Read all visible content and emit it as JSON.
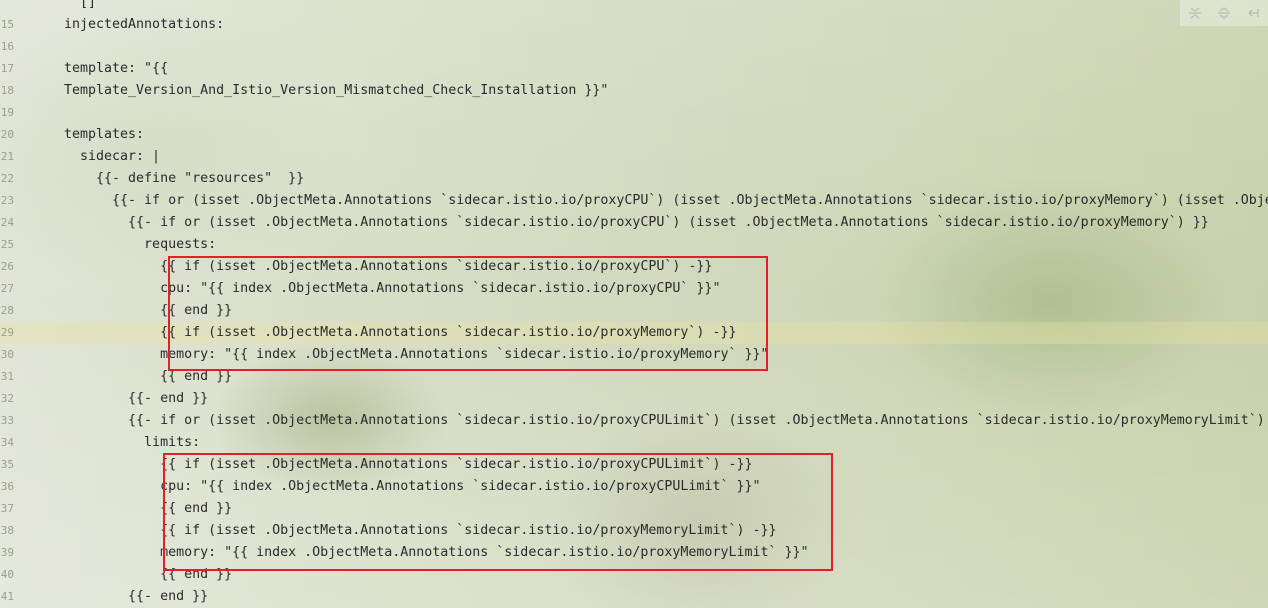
{
  "editor": {
    "lines": [
      {
        "number": "",
        "text": "  []"
      },
      {
        "number": "15",
        "text": "injectedAnnotations:"
      },
      {
        "number": "16",
        "text": ""
      },
      {
        "number": "17",
        "text": "template: \"{{"
      },
      {
        "number": "18",
        "text": "Template_Version_And_Istio_Version_Mismatched_Check_Installation }}\""
      },
      {
        "number": "19",
        "text": ""
      },
      {
        "number": "20",
        "text": "templates:"
      },
      {
        "number": "21",
        "text": "  sidecar: |"
      },
      {
        "number": "22",
        "text": "    {{- define \"resources\"  }}"
      },
      {
        "number": "23",
        "text": "      {{- if or (isset .ObjectMeta.Annotations `sidecar.istio.io/proxyCPU`) (isset .ObjectMeta.Annotations `sidecar.istio.io/proxyMemory`) (isset .ObjectMeta.Annotations"
      },
      {
        "number": "24",
        "text": "        {{- if or (isset .ObjectMeta.Annotations `sidecar.istio.io/proxyCPU`) (isset .ObjectMeta.Annotations `sidecar.istio.io/proxyMemory`) }}"
      },
      {
        "number": "25",
        "text": "          requests:"
      },
      {
        "number": "26",
        "text": "            {{ if (isset .ObjectMeta.Annotations `sidecar.istio.io/proxyCPU`) -}}"
      },
      {
        "number": "27",
        "text": "            cpu: \"{{ index .ObjectMeta.Annotations `sidecar.istio.io/proxyCPU` }}\""
      },
      {
        "number": "28",
        "text": "            {{ end }}"
      },
      {
        "number": "29",
        "text": "            {{ if (isset .ObjectMeta.Annotations `sidecar.istio.io/proxyMemory`) -}}"
      },
      {
        "number": "30",
        "text": "            memory: \"{{ index .ObjectMeta.Annotations `sidecar.istio.io/proxyMemory` }}\""
      },
      {
        "number": "31",
        "text": "            {{ end }}"
      },
      {
        "number": "32",
        "text": "        {{- end }}"
      },
      {
        "number": "33",
        "text": "        {{- if or (isset .ObjectMeta.Annotations `sidecar.istio.io/proxyCPULimit`) (isset .ObjectMeta.Annotations `sidecar.istio.io/proxyMemoryLimit`) }}"
      },
      {
        "number": "34",
        "text": "          limits:"
      },
      {
        "number": "35",
        "text": "            {{ if (isset .ObjectMeta.Annotations `sidecar.istio.io/proxyCPULimit`) -}}"
      },
      {
        "number": "36",
        "text": "            cpu: \"{{ index .ObjectMeta.Annotations `sidecar.istio.io/proxyCPULimit` }}\""
      },
      {
        "number": "37",
        "text": "            {{ end }}"
      },
      {
        "number": "38",
        "text": "            {{ if (isset .ObjectMeta.Annotations `sidecar.istio.io/proxyMemoryLimit`) -}}"
      },
      {
        "number": "39",
        "text": "            memory: \"{{ index .ObjectMeta.Annotations `sidecar.istio.io/proxyMemoryLimit` }}\""
      },
      {
        "number": "40",
        "text": "            {{ end }}"
      },
      {
        "number": "41",
        "text": "        {{- end }}"
      }
    ]
  },
  "toolbar": {
    "icons": [
      "fold-all-icon",
      "unfold-icon",
      "collapse-arrow-icon"
    ]
  },
  "colors": {
    "highlight_box": "#e0202a",
    "caret_row": "#ebe1a0",
    "code_text": "#2b2b2b",
    "line_number": "#9aa08c"
  }
}
